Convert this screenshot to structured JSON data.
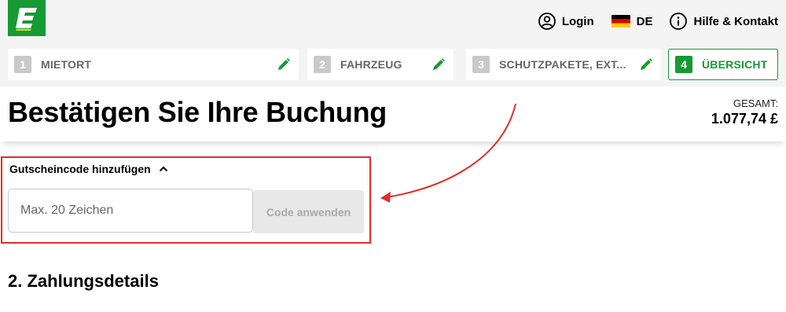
{
  "brand": {
    "logo_letter": "E",
    "color": "#169a34"
  },
  "header": {
    "login_label": "Login",
    "language_label": "DE",
    "help_label": "Hilfe & Kontakt"
  },
  "steps": [
    {
      "number": "1",
      "label": "MIETORT"
    },
    {
      "number": "2",
      "label": "FAHRZEUG"
    },
    {
      "number": "3",
      "label": "SCHUTZPAKETE, EXT..."
    },
    {
      "number": "4",
      "label": "ÜBERSICHT"
    }
  ],
  "page": {
    "title": "Bestätigen Sie Ihre Buchung",
    "total_label": "GESAMT:",
    "total_value": "1.077,74 £"
  },
  "voucher": {
    "toggle_label": "Gutscheincode hinzufügen",
    "input_placeholder": "Max. 20 Zeichen",
    "apply_label": "Code anwenden"
  },
  "payment": {
    "heading": "2. Zahlungsdetails"
  },
  "colors": {
    "accent": "#169a34",
    "highlight": "#e02e28"
  }
}
